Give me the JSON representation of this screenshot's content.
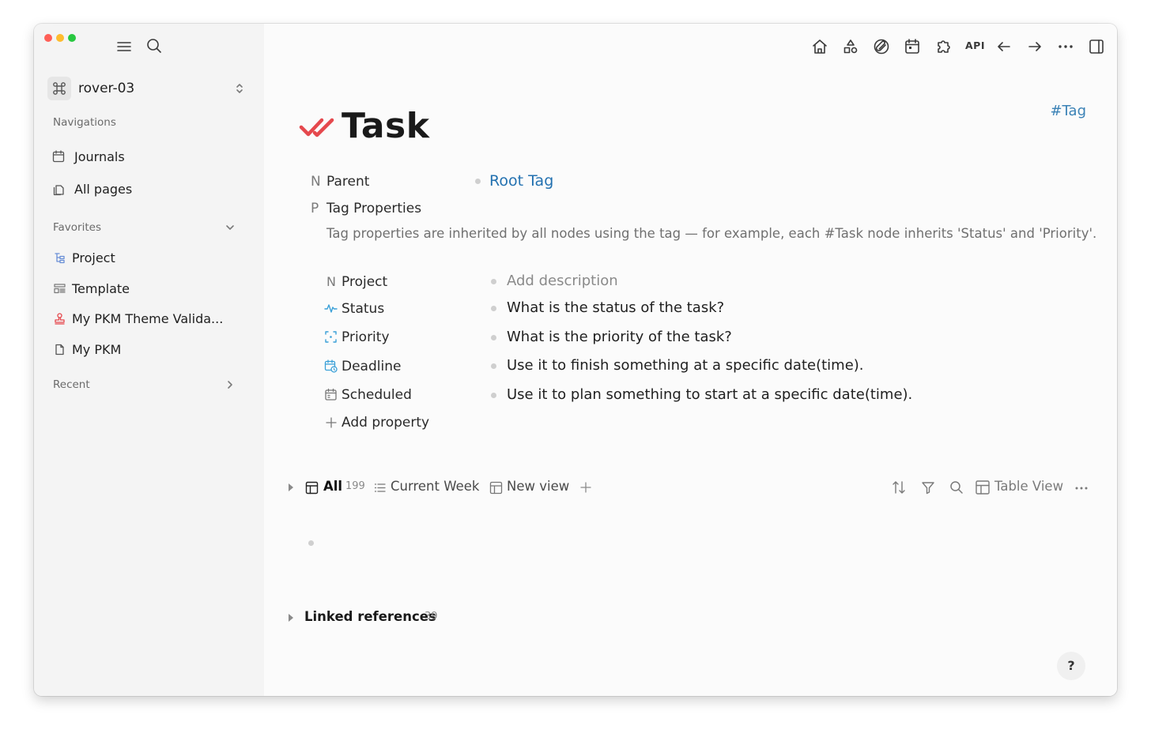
{
  "window": {
    "traffic_lights": {
      "close": "#ff5f57",
      "minimize": "#febc2e",
      "maximize": "#28c840"
    }
  },
  "sidebar": {
    "workspace": {
      "name": "rover-03",
      "icon": "command-icon"
    },
    "navigations": {
      "label": "Navigations",
      "items": [
        {
          "label": "Journals",
          "icon": "calendar-icon"
        },
        {
          "label": "All pages",
          "icon": "pages-icon"
        }
      ]
    },
    "favorites": {
      "label": "Favorites",
      "items": [
        {
          "label": "Project",
          "icon": "tree-icon"
        },
        {
          "label": "Template",
          "icon": "template-icon"
        },
        {
          "label": "My PKM Theme Valida...",
          "icon": "stamp-icon"
        },
        {
          "label": "My PKM",
          "icon": "page-icon"
        }
      ]
    },
    "recent": {
      "label": "Recent"
    }
  },
  "toolbar": {
    "api_label": "API"
  },
  "page": {
    "title": "Task",
    "tag_link": "#Tag",
    "accent_color": "#e5484d",
    "properties": {
      "parent": {
        "letter": "N",
        "name": "Parent",
        "value": "Root Tag"
      },
      "tag_properties": {
        "letter": "P",
        "name": "Tag Properties",
        "description": "Tag properties are inherited by all nodes using the tag — for example, each #Task node inherits 'Status' and 'Priority'."
      }
    },
    "tag_props": [
      {
        "icon_label": "N",
        "name": "Project",
        "value": "Add description",
        "placeholder": true
      },
      {
        "name": "Status",
        "value": "What is the status of the task?"
      },
      {
        "name": "Priority",
        "value": "What is the priority of the task?"
      },
      {
        "name": "Deadline",
        "value": "Use it to finish something at a specific date(time)."
      },
      {
        "name": "Scheduled",
        "value": "Use it to plan something to start at a specific date(time)."
      }
    ],
    "add_property": "Add property",
    "views": {
      "all_label": "All",
      "all_count": "199",
      "current_week": "Current Week",
      "new_view": "New view",
      "table_view": "Table View"
    },
    "linked_refs": {
      "label": "Linked references",
      "count": "39"
    },
    "help": "?"
  }
}
